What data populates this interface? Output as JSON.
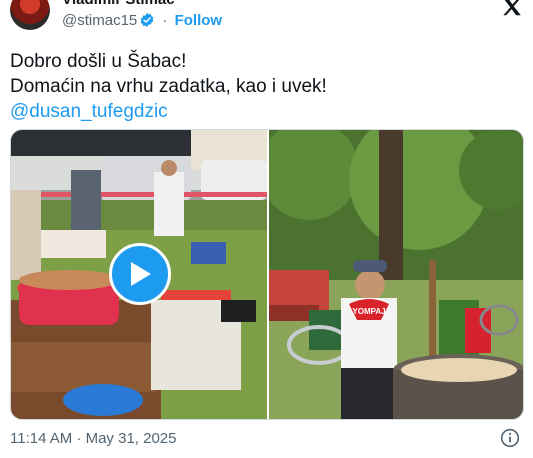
{
  "author": {
    "display_name": "Vladimir Stimac",
    "handle": "@stimac15",
    "verified_icon": "verified-badge",
    "follow_label": "Follow",
    "separator": "·"
  },
  "tweet": {
    "line1": "Dobro došli u Šabac!",
    "line2": "Domaćin na vrhu zadatka, kao i uvek!",
    "mention": "@dusan_tufegdzic"
  },
  "media": {
    "left_photo": {
      "type": "video",
      "play_icon": "play-icon"
    },
    "right_photo": {
      "type": "image",
      "apron_text": "YOMPAJ"
    }
  },
  "footer": {
    "timestamp": "11:14 AM · May 31, 2025",
    "info_icon": "info-icon"
  },
  "colors": {
    "accent": "#1d9bf0",
    "secondary_text": "#536471",
    "text": "#0f1419"
  }
}
